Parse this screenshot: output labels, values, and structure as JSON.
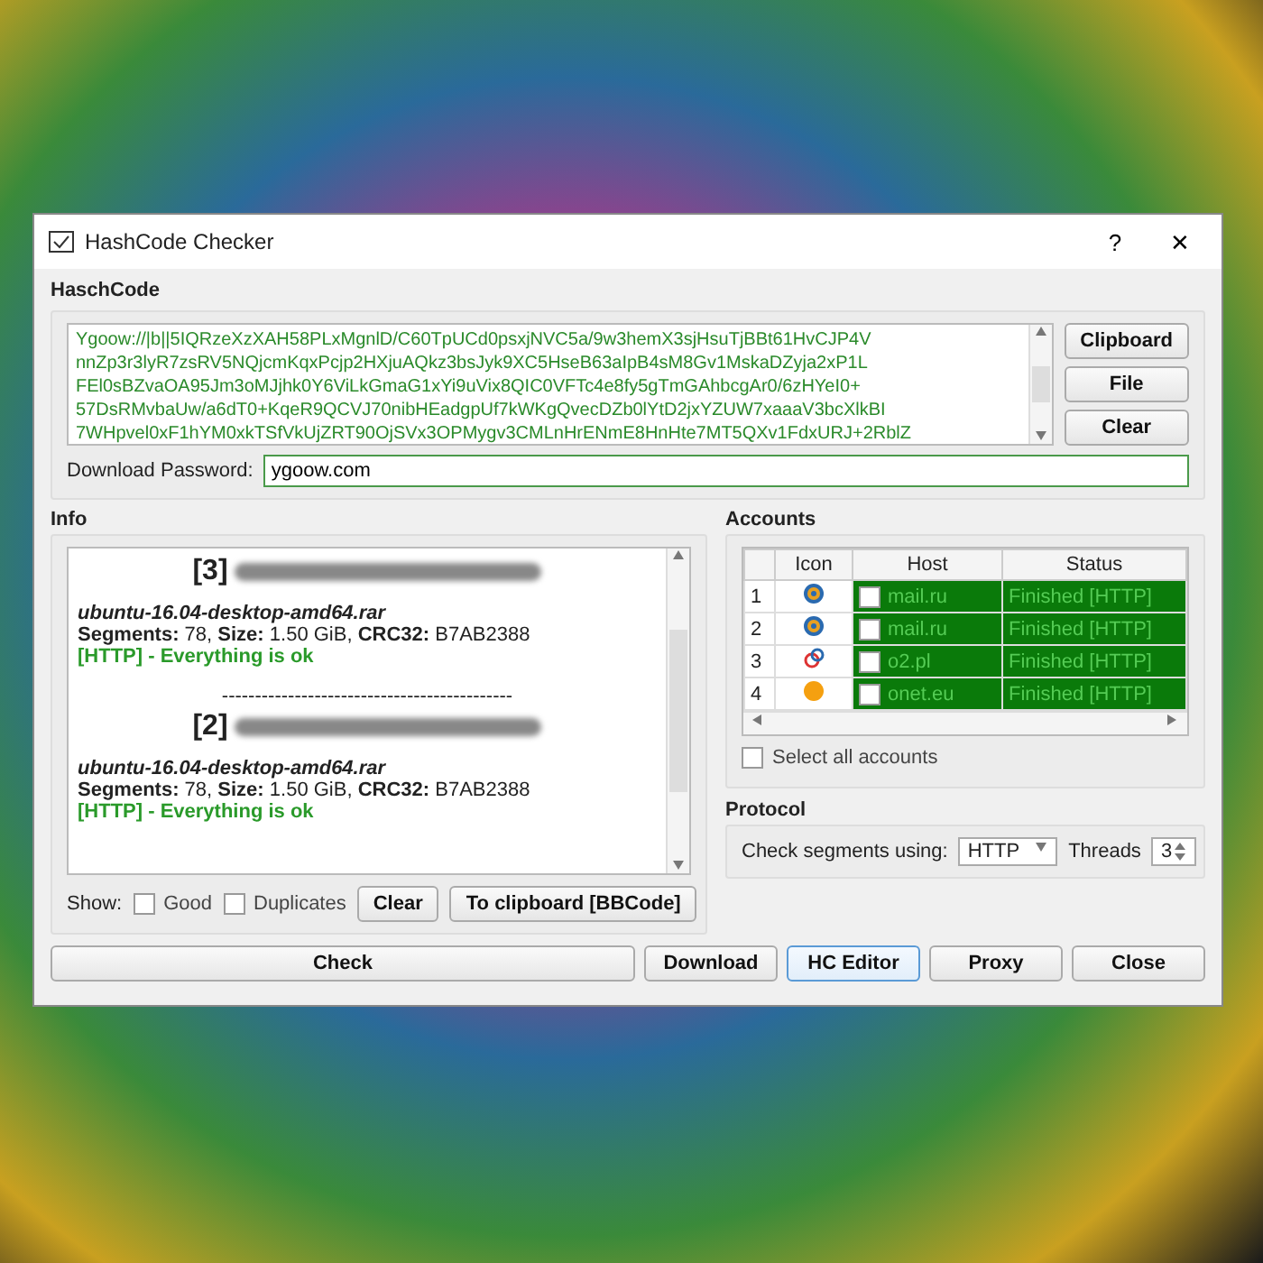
{
  "window": {
    "title": "HashCode Checker",
    "help": "?",
    "close": "✕"
  },
  "hashcode": {
    "title": "HaschCode",
    "lines": [
      "Ygoow://|b||5IQRzeXzXAH58PLxMgnlD/C60TpUCd0psxjNVC5a/9w3hemX3sjHsuTjBBt61HvCJP4V",
      "nnZp3r3lyR7zsRV5NQjcmKqxPcjp2HXjuAQkz3bsJyk9XC5HseB63aIpB4sM8Gv1MskaDZyja2xP1L",
      "FEl0sBZvaOA95Jm3oMJjhk0Y6ViLkGmaG1xYi9uVix8QIC0VFTc4e8fy5gTmGAhbcgAr0/6zHYeI0+",
      "57DsRMvbaUw/a6dT0+KqeR9QCVJ70nibHEadgpUf7kWKgQvecDZb0lYtD2jxYZUW7xaaaV3bcXlkBI",
      "7WHpvel0xF1hYM0xkTSfVkUjZRT90OjSVx3OPMygv3CMLnHrENmE8HnHte7MT5QXv1FdxURJ+2RblZ"
    ],
    "buttons": [
      "Clipboard",
      "File",
      "Clear"
    ],
    "password_label": "Download Password:",
    "password": "ygoow.com"
  },
  "info": {
    "title": "Info",
    "entries": [
      {
        "index": "[3]",
        "file": "ubuntu-16.04-desktop-amd64.rar",
        "details": "**Segments:** 78, **Size:** 1.50 GiB, **CRC32:** B7AB2388",
        "status": "[HTTP] - Everything is ok"
      },
      {
        "index": "[2]",
        "separator": "--------------------------------------------",
        "file": "ubuntu-16.04-desktop-amd64.rar",
        "details": "**Segments:** 78, **Size:** 1.50 GiB, **CRC32:** B7AB2388",
        "status": "[HTTP] - Everything is ok"
      }
    ],
    "show_label": "Show:",
    "filters": [
      {
        "label": "Good",
        "checked": false
      },
      {
        "label": "Duplicates",
        "checked": false
      }
    ],
    "buttons": [
      "Clear",
      "To clipboard [BBCode]"
    ]
  },
  "accounts": {
    "title": "Accounts",
    "columns": [
      "Icon",
      "Host",
      "Status"
    ],
    "rows": [
      {
        "number": "1",
        "kind": "mail",
        "checked": false,
        "host": "mail.ru",
        "status": "Finished [HTTP]"
      },
      {
        "number": "2",
        "kind": "mail",
        "checked": false,
        "host": "mail.ru",
        "status": "Finished [HTTP]"
      },
      {
        "number": "3",
        "kind": "rings",
        "checked": false,
        "host": "o2.pl",
        "status": "Finished [HTTP]"
      },
      {
        "number": "4",
        "kind": "ball",
        "checked": false,
        "host": "onet.eu",
        "status": "Finished [HTTP]"
      }
    ],
    "select_all": {
      "label": "Select all accounts",
      "checked": false
    }
  },
  "protocol": {
    "title": "Protocol",
    "label": "Check segments using:",
    "method": "HTTP",
    "threads_label": "Threads",
    "threads": "3"
  },
  "footer": {
    "check": "Check",
    "buttons": [
      {
        "label": "Download",
        "focused": false
      },
      {
        "label": "HC Editor",
        "focused": true
      },
      {
        "label": "Proxy",
        "focused": false
      },
      {
        "label": "Close",
        "focused": false
      }
    ]
  }
}
